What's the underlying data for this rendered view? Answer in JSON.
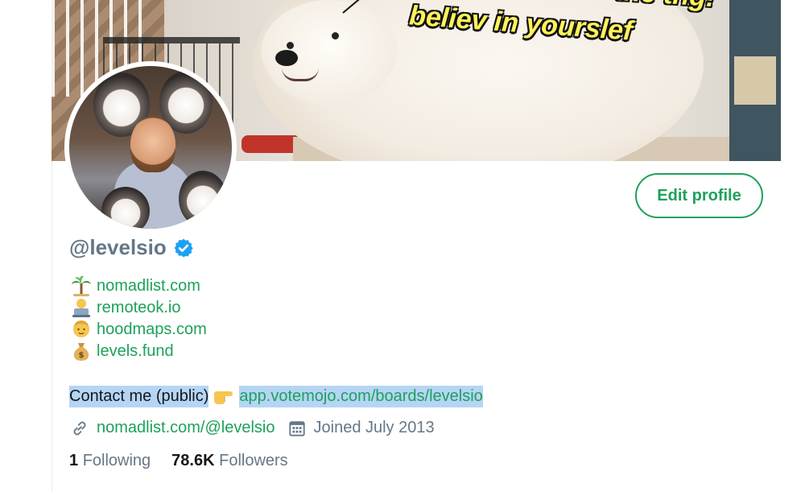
{
  "banner": {
    "caption_main": "believ in yourslef",
    "caption_top": "the thg!"
  },
  "profile": {
    "handle": "@levelsio",
    "edit_button_label": "Edit profile"
  },
  "bio_links": [
    {
      "icon": "palm-tree-icon",
      "text": "nomadlist.com"
    },
    {
      "icon": "technologist-icon",
      "text": "remoteok.io"
    },
    {
      "icon": "person-icon",
      "text": "hoodmaps.com"
    },
    {
      "icon": "money-bag-icon",
      "text": "levels.fund"
    }
  ],
  "contact": {
    "label": "Contact me (public)",
    "link": "app.votemojo.com/boards/levelsio",
    "icon": "pointing-right-icon"
  },
  "meta": {
    "website": "nomadlist.com/@levelsio",
    "joined": "Joined July 2013"
  },
  "stats": {
    "following_count": "1",
    "following_label": "Following",
    "followers_count": "78.6K",
    "followers_label": "Followers"
  },
  "colors": {
    "accent": "#1da15a",
    "muted": "#657786",
    "verified": "#1da1f2",
    "selection": "#b5d5f5"
  }
}
